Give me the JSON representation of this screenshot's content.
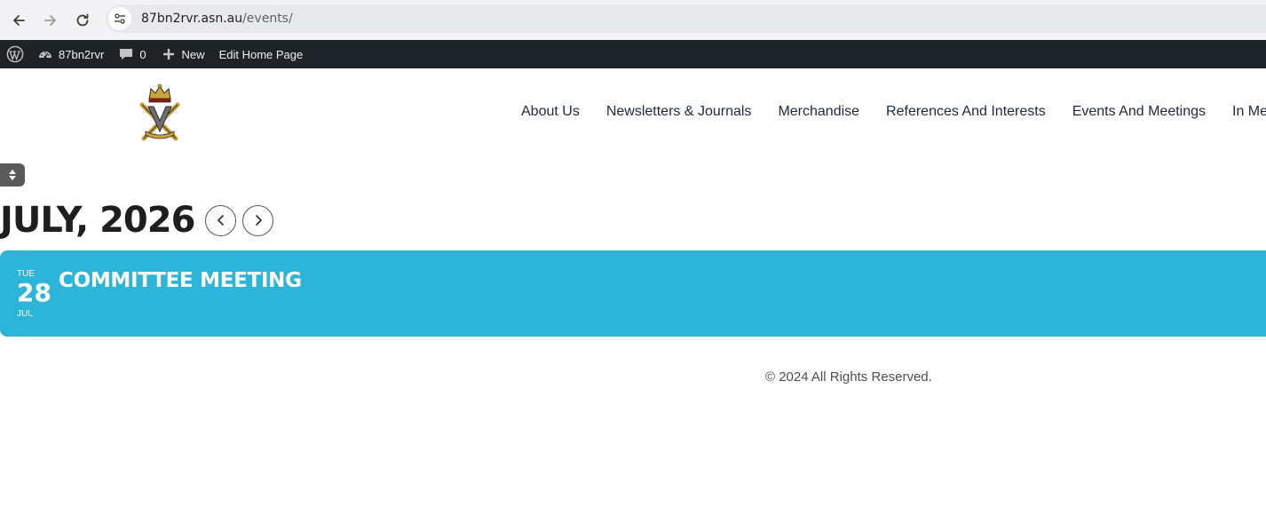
{
  "browser": {
    "url_domain": "87bn2rvr.asn.au",
    "url_path": "/events/",
    "icons": [
      "back-arrow-icon",
      "forward-arrow-icon",
      "reload-icon",
      "site-info-icon"
    ]
  },
  "admin_bar": {
    "site_name": "87bn2rvr",
    "comments_count": "0",
    "new_label": "New",
    "edit_label": "Edit Home Page",
    "icons": [
      "wordpress-logo-icon",
      "dashboard-icon",
      "comment-icon",
      "plus-icon"
    ]
  },
  "nav": {
    "items": [
      "About Us",
      "Newsletters & Journals",
      "Merchandise",
      "References And Interests",
      "Events And Meetings",
      "In Mem"
    ]
  },
  "calendar": {
    "month_title": "JULY, 2026"
  },
  "events": [
    {
      "dow": "TUE",
      "day": "28",
      "month": "JUL",
      "title": "COMMITTEE MEETING"
    }
  ],
  "footer": {
    "copyright": "© 2024 All Rights Reserved."
  },
  "colors": {
    "event_card": "#2cb5d8",
    "admin_bar": "#1d2327",
    "browser_bar": "#f3f3f5"
  }
}
